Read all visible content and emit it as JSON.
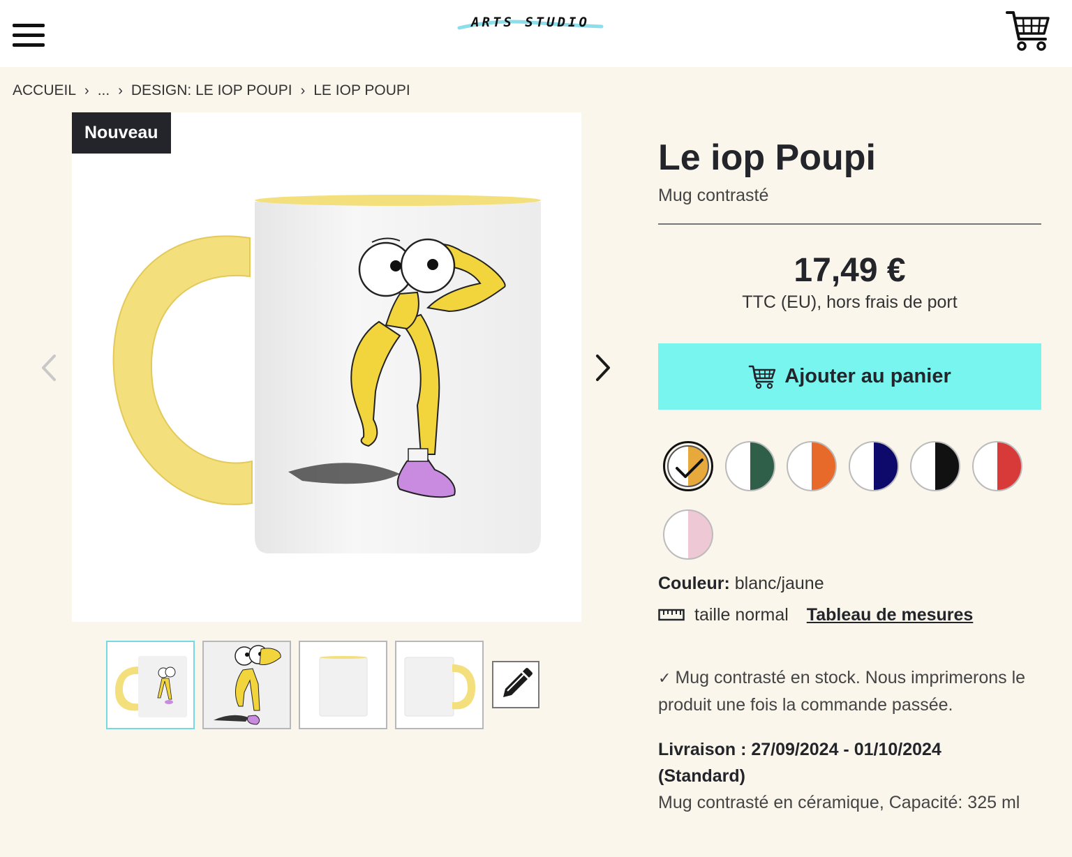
{
  "header": {
    "logo_text": "ARTS STUDIO",
    "menu_icon": "hamburger-menu-icon",
    "cart_icon": "shopping-cart-icon"
  },
  "breadcrumb": {
    "items": [
      "ACCUEIL",
      "...",
      "DESIGN: LE IOP POUPI",
      "LE IOP POUPI"
    ],
    "separator_icon": "chevron-right-icon"
  },
  "gallery": {
    "badge": "Nouveau",
    "prev_icon": "chevron-left-icon",
    "next_icon": "chevron-right-icon",
    "thumbnails": [
      "mug-front",
      "design-only",
      "mug-side-plain",
      "mug-back-handle"
    ],
    "active_thumbnail": 0,
    "edit_icon": "pencil-icon"
  },
  "product": {
    "title": "Le iop Poupi",
    "subtitle": "Mug contrasté",
    "price": "17,49 €",
    "tax_note": "TTC (EU), hors frais de port",
    "add_to_cart": "Ajouter au panier",
    "swatches": [
      {
        "accent": "#e8a93c",
        "selected": true
      },
      {
        "accent": "#2f5f48",
        "selected": false
      },
      {
        "accent": "#e86a2a",
        "selected": false
      },
      {
        "accent": "#0d0a6b",
        "selected": false
      },
      {
        "accent": "#111111",
        "selected": false
      },
      {
        "accent": "#d83a3a",
        "selected": false
      },
      {
        "accent": "#eec8d4",
        "selected": false
      }
    ],
    "color_label": "Couleur:",
    "color_value": "blanc/jaune",
    "size_icon": "ruler-icon",
    "size_text": "taille normal",
    "size_chart_link": "Tableau de mesures",
    "stock_text": "Mug contrasté en stock. Nous imprimerons le produit une fois la commande passée.",
    "delivery_line1": "Livraison : 27/09/2024 - 01/10/2024",
    "delivery_line2": "(Standard)",
    "description": "Mug contrasté en céramique, Capacité: 325 ml"
  },
  "colors": {
    "header_bg": "#ffffff",
    "page_bg": "#faf6ec",
    "button_bg": "#79f5f0",
    "badge_bg": "#23252a",
    "mug_accent": "#f3df7c"
  }
}
